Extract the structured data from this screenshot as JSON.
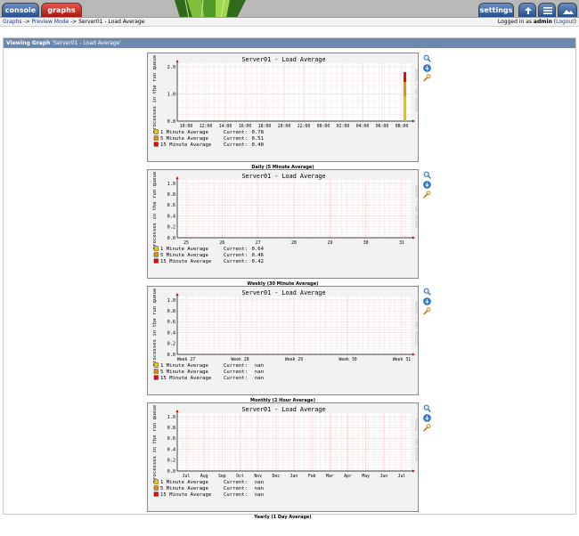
{
  "tabs": {
    "console": "console",
    "graphs": "graphs",
    "settings": "settings"
  },
  "breadcrumb": {
    "graphs": "Graphs",
    "sep1": " -> ",
    "preview": "Preview Mode",
    "sep2": " -> ",
    "current": "Server01 - Load Average"
  },
  "login": {
    "prefix": "Logged in as ",
    "user": "admin",
    "open": " (",
    "logout": "Logout",
    "close": ")"
  },
  "panel": {
    "prefix": "Viewing Graph ",
    "name": "'Server01 - Load Average'"
  },
  "icons": {
    "zoom": "magnifier-icon",
    "export": "export-csv-icon",
    "properties": "wrench-icon"
  },
  "colors": {
    "topbar": "#b8b8b8",
    "header": "#6d88ad",
    "series1": "#eacc00",
    "series2": "#ea8f00",
    "series3": "#ff0000",
    "grid": "#f4a0a0",
    "canvas": "#ffffff",
    "back": "#f2f2f2"
  },
  "graphs": [
    {
      "title": "Server01 - Load Average",
      "ylabel": "processes in the run queue",
      "watermark": "RRDTOOL / TOBI OETIKER",
      "caption": "Daily (5 Minute Average)",
      "yticks": [
        "2.0",
        "1.0",
        "0.0"
      ],
      "xticks": [
        "10:00",
        "12:00",
        "14:00",
        "16:00",
        "18:00",
        "20:00",
        "22:00",
        "00:00",
        "02:00",
        "04:00",
        "06:00",
        "08:00"
      ],
      "legend": [
        {
          "label": "1 Minute Average",
          "current_label": "Current:",
          "current": "0.78"
        },
        {
          "label": "5 Minute Average",
          "current_label": "Current:",
          "current": "0.51"
        },
        {
          "label": "15 Minute Average",
          "current_label": "Current:",
          "current": "0.40"
        }
      ]
    },
    {
      "title": "Server01 - Load Average",
      "ylabel": "processes in the run queue",
      "watermark": "RRDTOOL / TOBI OETIKER",
      "caption": "Weekly (30 Minute Average)",
      "yticks": [
        "1.0",
        "0.8",
        "0.6",
        "0.4",
        "0.2",
        "0.0"
      ],
      "xticks": [
        "25",
        "26",
        "27",
        "28",
        "29",
        "30",
        "31"
      ],
      "legend": [
        {
          "label": "1 Minute Average",
          "current_label": "Current:",
          "current": "0.64"
        },
        {
          "label": "5 Minute Average",
          "current_label": "Current:",
          "current": "0.46"
        },
        {
          "label": "15 Minute Average",
          "current_label": "Current:",
          "current": "0.42"
        }
      ]
    },
    {
      "title": "Server01 - Load Average",
      "ylabel": "processes in the run queue",
      "watermark": "RRDTOOL / TOBI OETIKER",
      "caption": "Monthly (2 Hour Average)",
      "yticks": [
        "1.0",
        "0.8",
        "0.6",
        "0.4",
        "0.2",
        "0.0"
      ],
      "xticks": [
        "Week 27",
        "Week 28",
        "Week 29",
        "Week 30",
        "Week 31"
      ],
      "legend": [
        {
          "label": "1 Minute Average",
          "current_label": "Current:",
          "current": "nan"
        },
        {
          "label": "5 Minute Average",
          "current_label": "Current:",
          "current": "nan"
        },
        {
          "label": "15 Minute Average",
          "current_label": "Current:",
          "current": "nan"
        }
      ]
    },
    {
      "title": "Server01 - Load Average",
      "ylabel": "processes in the run queue",
      "watermark": "RRDTOOL / TOBI OETIKER",
      "caption": "Yearly (1 Day Average)",
      "yticks": [
        "1.0",
        "0.8",
        "0.6",
        "0.4",
        "0.2",
        "0.0"
      ],
      "xticks": [
        "Jul",
        "Aug",
        "Sep",
        "Oct",
        "Nov",
        "Dec",
        "Jan",
        "Feb",
        "Mar",
        "Apr",
        "May",
        "Jun",
        "Jul"
      ],
      "legend": [
        {
          "label": "1 Minute Average",
          "current_label": "Current:",
          "current": "nan"
        },
        {
          "label": "5 Minute Average",
          "current_label": "Current:",
          "current": "nan"
        },
        {
          "label": "15 Minute Average",
          "current_label": "Current:",
          "current": "nan"
        }
      ]
    }
  ]
}
